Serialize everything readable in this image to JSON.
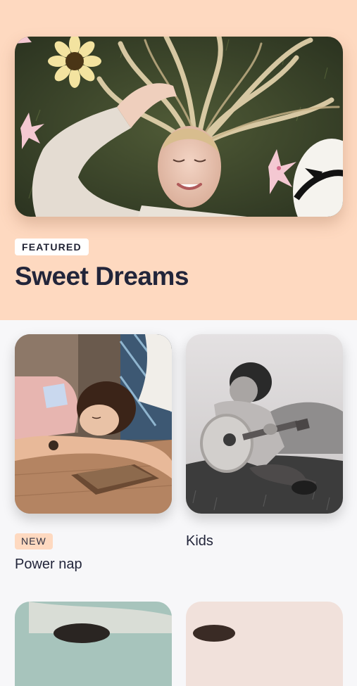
{
  "featured": {
    "badge": "FEATURED",
    "title": "Sweet Dreams",
    "image": "woman-lying-in-grass-with-flowers-photo"
  },
  "tiles": [
    {
      "label": "Power nap",
      "badge": "NEW",
      "image": "child-sleeping-on-table-with-book-photo"
    },
    {
      "label": "Kids",
      "image": "boy-playing-guitar-in-field-bw-photo"
    },
    {
      "image": "tile-photo-partially-visible"
    },
    {
      "image": "tile-photo-partially-visible"
    }
  ],
  "colors": {
    "hero_background": "#fed9c0",
    "page_background": "#f7f7f9",
    "title_text": "#22253a",
    "new_badge_background": "#fed9c0",
    "featured_badge_background": "#ffffff"
  }
}
